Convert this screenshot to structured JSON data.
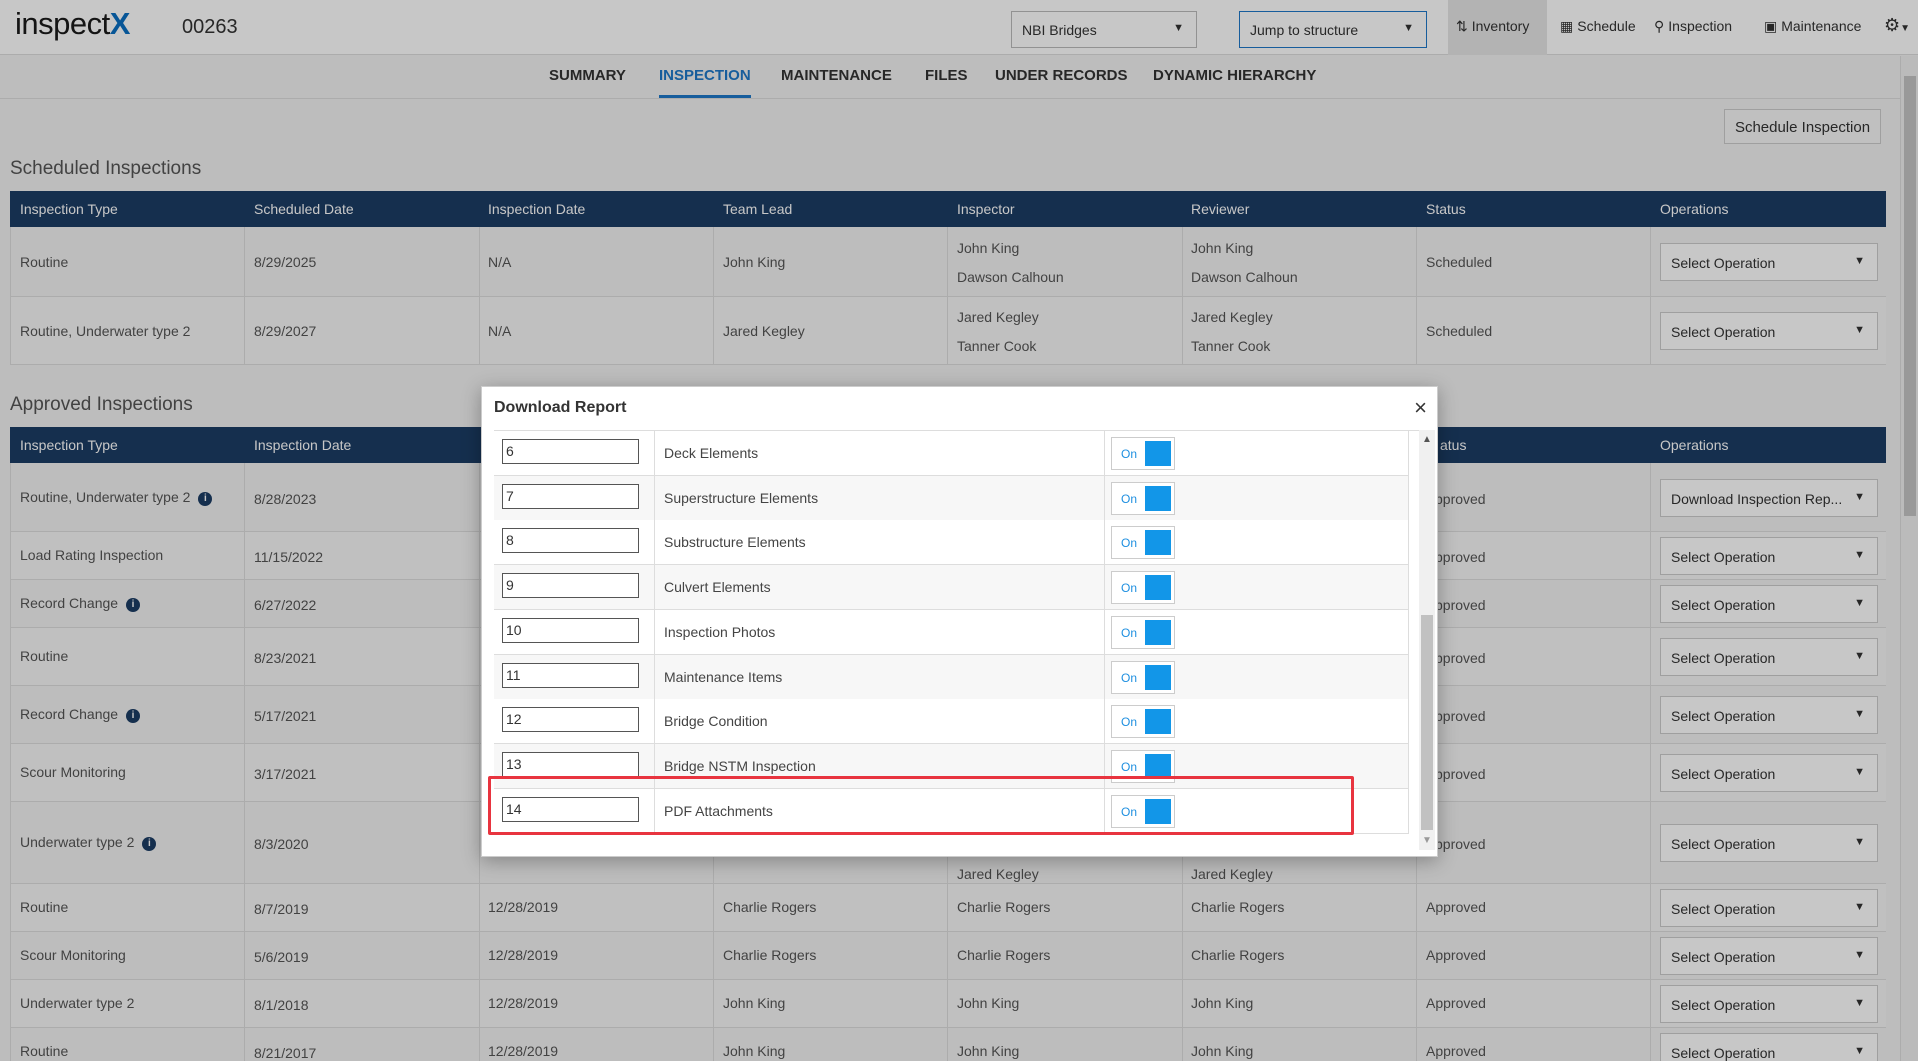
{
  "app": {
    "logo_text": "inspect",
    "logo_accent": "X",
    "structure_id": "00263"
  },
  "header": {
    "asset_select": "NBI Bridges",
    "jump_select": "Jump to structure",
    "nav": [
      {
        "label": "Inventory",
        "icon": "sort-icon"
      },
      {
        "label": "Schedule",
        "icon": "calendar-icon"
      },
      {
        "label": "Inspection",
        "icon": "search-icon"
      },
      {
        "label": "Maintenance",
        "icon": "toolbox-icon"
      }
    ]
  },
  "tabs": [
    "SUMMARY",
    "INSPECTION",
    "MAINTENANCE",
    "FILES",
    "UNDER RECORDS",
    "DYNAMIC HIERARCHY"
  ],
  "active_tab": "INSPECTION",
  "schedule_button": "Schedule Inspection",
  "scheduled": {
    "title": "Scheduled Inspections",
    "columns": [
      "Inspection Type",
      "Scheduled Date",
      "Inspection Date",
      "Team Lead",
      "Inspector",
      "Reviewer",
      "Status",
      "Operations"
    ],
    "rows": [
      {
        "type": "Routine",
        "sched": "8/29/2025",
        "insp": "N/A",
        "lead": "John King",
        "inspector1": "John King",
        "inspector2": "Dawson Calhoun",
        "reviewer1": "John King",
        "reviewer2": "Dawson Calhoun",
        "status": "Scheduled",
        "op": "Select Operation"
      },
      {
        "type": "Routine, Underwater type 2",
        "sched": "8/29/2027",
        "insp": "N/A",
        "lead": "Jared Kegley",
        "inspector1": "Jared Kegley",
        "inspector2": "Tanner Cook",
        "reviewer1": "Jared Kegley",
        "reviewer2": "Tanner Cook",
        "status": "Scheduled",
        "op": "Select Operation"
      }
    ]
  },
  "approved": {
    "title": "Approved Inspections",
    "columns": [
      "Inspection Type",
      "Inspection Date",
      "atus",
      "Operations"
    ],
    "rows": [
      {
        "type": "Routine, Underwater type 2",
        "date": "8/28/2023",
        "status": "pproved",
        "op": "Download Inspection Rep..."
      },
      {
        "type": "Load Rating Inspection",
        "date": "11/15/2022",
        "status": "pproved",
        "op": "Select Operation"
      },
      {
        "type": "Record Change",
        "date": "6/27/2022",
        "status": "pproved",
        "op": "Select Operation"
      },
      {
        "type": "Routine",
        "date": "8/23/2021",
        "status": "pproved",
        "op": "Select Operation"
      },
      {
        "type": "Record Change",
        "date": "5/17/2021",
        "status": "pproved",
        "op": "Select Operation"
      },
      {
        "type": "Scour Monitoring",
        "date": "3/17/2021",
        "status": "pproved",
        "op": "Select Operation"
      },
      {
        "type": "Underwater type 2",
        "date": "8/3/2020",
        "status": "pproved",
        "op": "Select Operation",
        "peek_inspector": "Jared Kegley",
        "peek_reviewer": "Jared Kegley"
      },
      {
        "type": "Routine",
        "date": "8/7/2019",
        "insp": "12/28/2019",
        "lead": "Charlie Rogers",
        "inspector": "Charlie Rogers",
        "reviewer": "Charlie Rogers",
        "status": "Approved",
        "op": "Select Operation"
      },
      {
        "type": "Scour Monitoring",
        "date": "5/6/2019",
        "insp": "12/28/2019",
        "lead": "Charlie Rogers",
        "inspector": "Charlie Rogers",
        "reviewer": "Charlie Rogers",
        "status": "Approved",
        "op": "Select Operation"
      },
      {
        "type": "Underwater type 2",
        "date": "8/1/2018",
        "insp": "12/28/2019",
        "lead": "John King",
        "inspector": "John King",
        "reviewer": "John King",
        "status": "Approved",
        "op": "Select Operation"
      },
      {
        "type": "Routine",
        "date": "8/21/2017",
        "insp": "12/28/2019",
        "lead": "John King",
        "inspector": "John King",
        "reviewer": "John King",
        "status": "Approved",
        "op": "Select Operation"
      }
    ]
  },
  "modal": {
    "title": "Download Report",
    "close": "×",
    "toggle_on": "On",
    "sections": [
      {
        "order": "6",
        "name": "Deck Elements"
      },
      {
        "order": "7",
        "name": "Superstructure Elements"
      },
      {
        "order": "8",
        "name": "Substructure Elements"
      },
      {
        "order": "9",
        "name": "Culvert Elements"
      },
      {
        "order": "10",
        "name": "Inspection Photos"
      },
      {
        "order": "11",
        "name": "Maintenance Items"
      },
      {
        "order": "12",
        "name": "Bridge Condition"
      },
      {
        "order": "13",
        "name": "Bridge NSTM Inspection"
      },
      {
        "order": "14",
        "name": "PDF Attachments"
      }
    ]
  },
  "colors": {
    "header_table": "#1c3d65",
    "accent": "#1e78c8",
    "toggle": "#1296e8",
    "highlight": "#e8343f"
  }
}
